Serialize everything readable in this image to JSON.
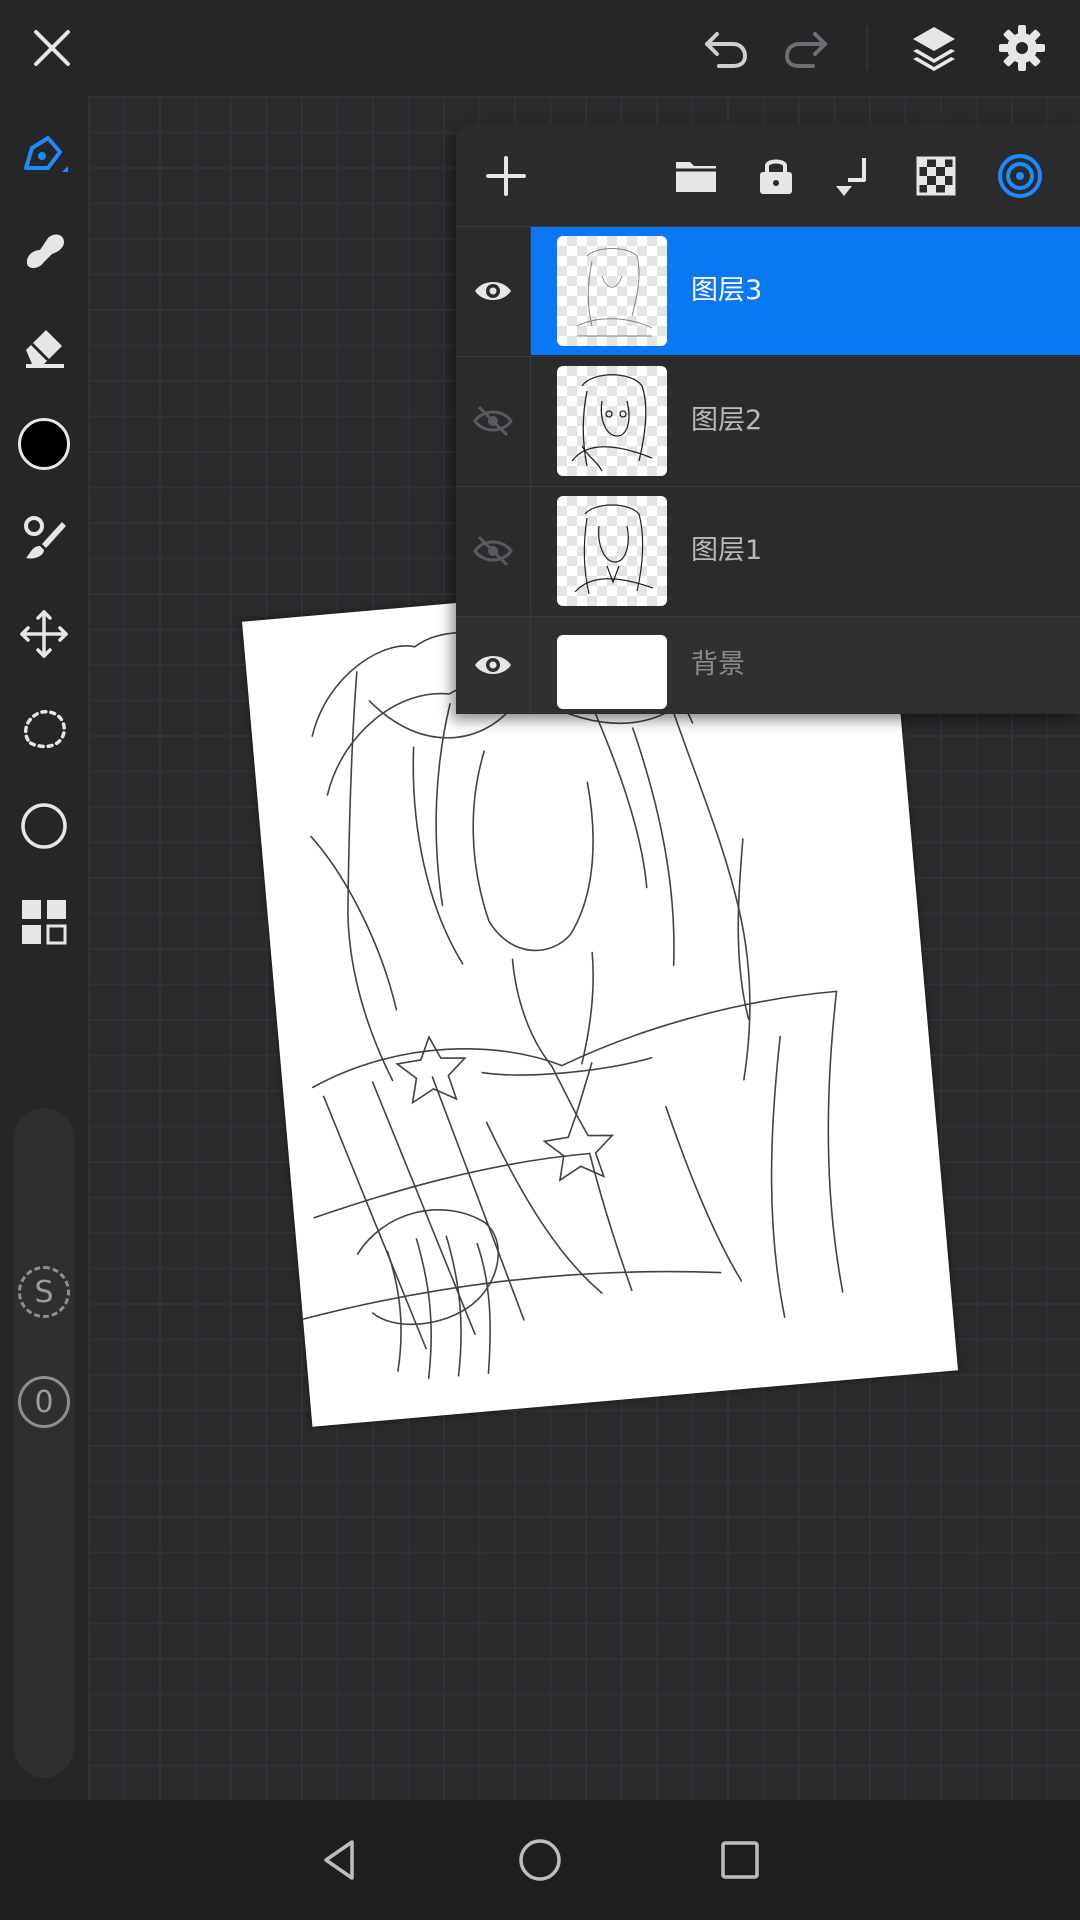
{
  "app": {
    "accent_color": "#0a77f5",
    "icons": {
      "close": "close-icon",
      "undo": "undo-icon",
      "redo": "redo-icon",
      "layers": "layers-icon",
      "settings": "gear-icon"
    }
  },
  "left_toolbar": {
    "tools": [
      "pen-tool",
      "smudge-tool",
      "eraser-tool",
      "color-swatch",
      "brush-settings",
      "transform-tool",
      "lasso-select",
      "shape-tool",
      "layers-grid"
    ],
    "current_color": "#000000",
    "size_badge": "S",
    "opacity_badge": "0"
  },
  "layers_panel": {
    "toolbar": [
      "add-layer",
      "folder",
      "lock",
      "merge-down",
      "transparency",
      "blend-mode"
    ],
    "layers": [
      {
        "name": "图层3",
        "visible": true,
        "selected": true
      },
      {
        "name": "图层2",
        "visible": false,
        "selected": false
      },
      {
        "name": "图层1",
        "visible": false,
        "selected": false
      },
      {
        "name": "背景",
        "visible": true,
        "selected": false
      }
    ]
  },
  "navbar": {
    "buttons": [
      "back",
      "home",
      "recents"
    ]
  }
}
